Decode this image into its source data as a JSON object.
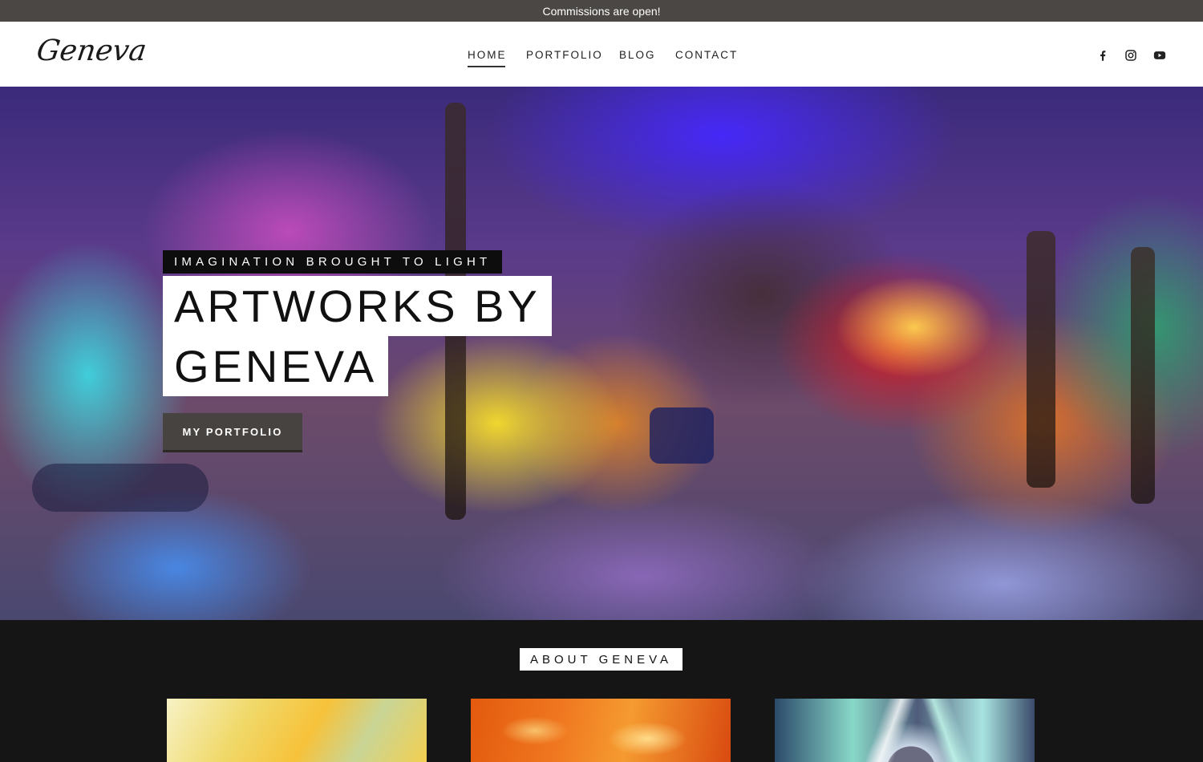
{
  "announcement": "Commissions are open!",
  "brand": {
    "logo_text": "Geneva"
  },
  "nav": {
    "items": [
      {
        "label": "HOME",
        "active": true
      },
      {
        "label": "PORTFOLIO",
        "active": false
      },
      {
        "label": "BLOG",
        "active": false
      },
      {
        "label": "CONTACT",
        "active": false
      }
    ]
  },
  "social": [
    {
      "icon": "facebook-icon"
    },
    {
      "icon": "instagram-icon"
    },
    {
      "icon": "youtube-icon"
    }
  ],
  "hero": {
    "eyebrow": "IMAGINATION BROUGHT TO LIGHT",
    "title_line1": "ARTWORKS BY",
    "title_line2": "GENEVA",
    "cta_label": "MY PORTFOLIO"
  },
  "about": {
    "label": "ABOUT GENEVA",
    "thumbnails": [
      "yellow-abstract-painting",
      "orange-impasto-painting",
      "holographic-abstract"
    ]
  },
  "colors": {
    "announcement_bg": "#4a4744",
    "header_bg": "#ffffff",
    "cta_bg": "#474340",
    "section_bg": "#151515"
  }
}
